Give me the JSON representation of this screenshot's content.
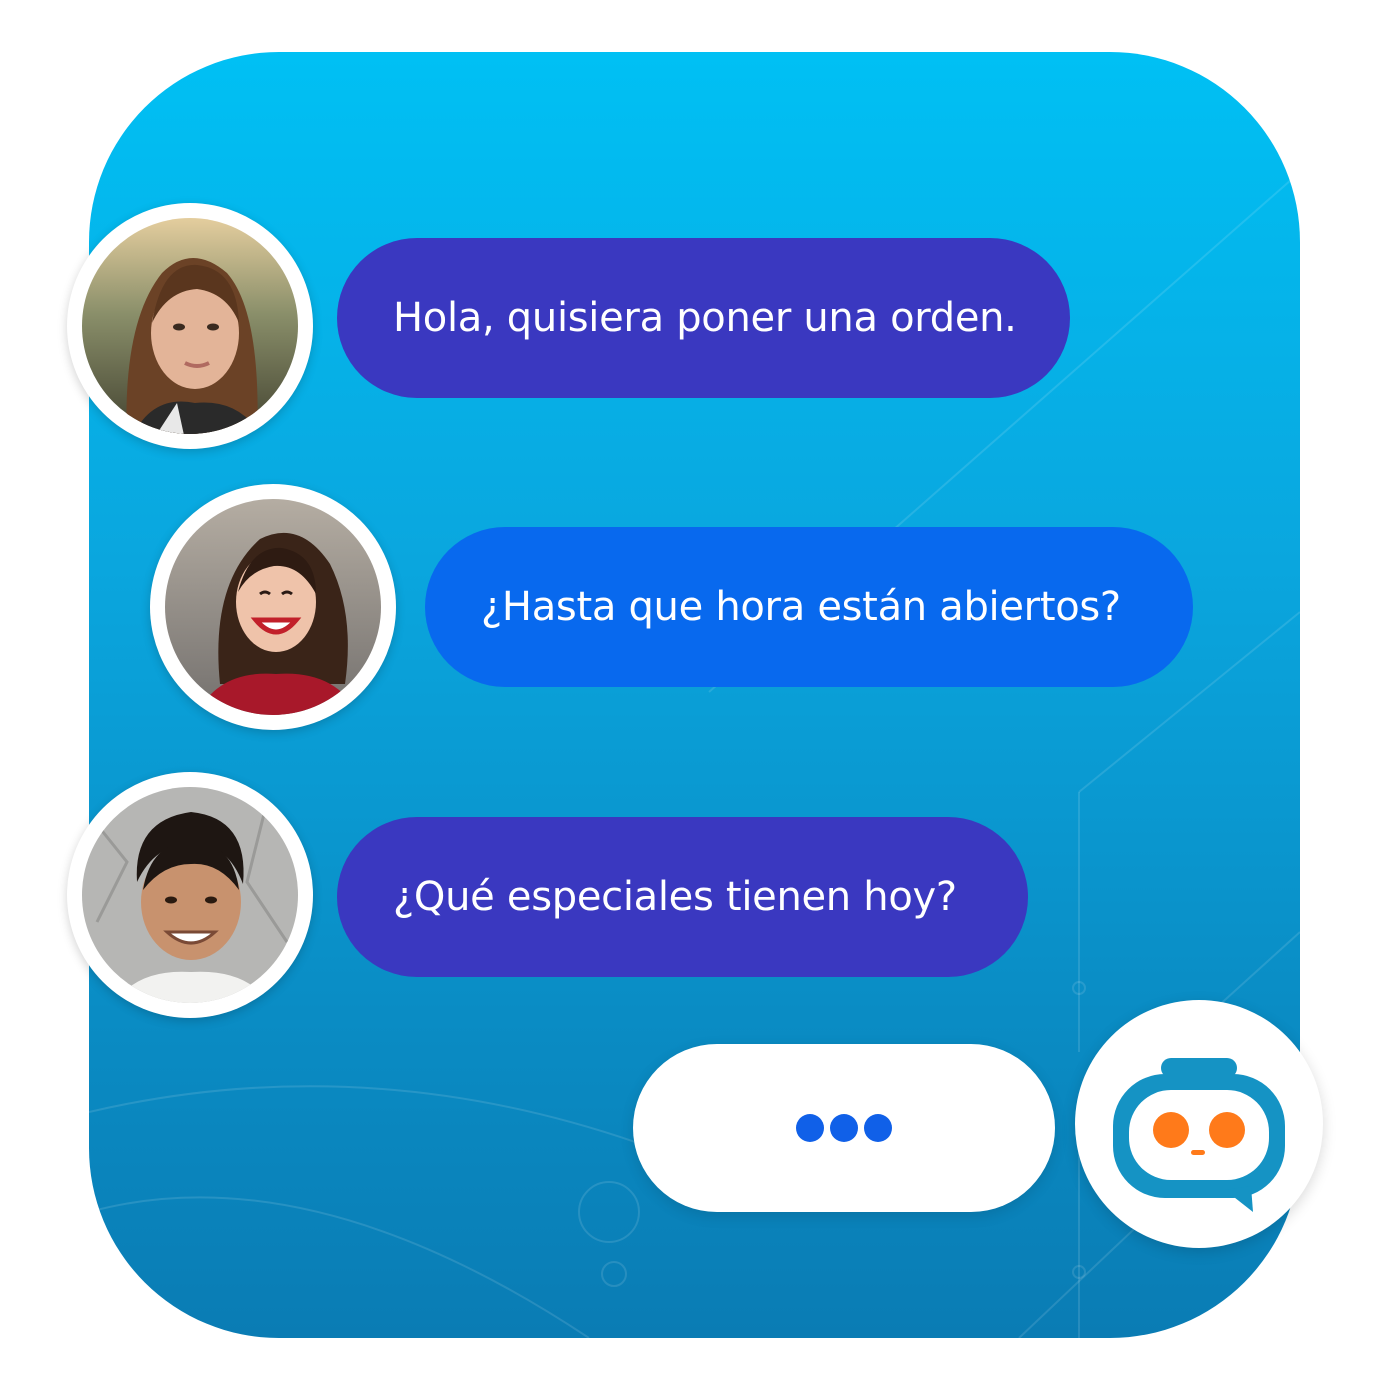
{
  "chat": {
    "messages": [
      {
        "text": "Hola, quisiera poner una orden.",
        "avatar": "user-woman-long-hair"
      },
      {
        "text": "¿Hasta que hora están abiertos?",
        "avatar": "user-woman-smiling"
      },
      {
        "text": "¿Qué especiales tienen hoy?",
        "avatar": "user-man-smiling"
      }
    ],
    "typing_indicator": {
      "icon": "typing-dots-icon"
    },
    "bot": {
      "icon": "robot-icon"
    }
  },
  "colors": {
    "panel_top": "#00c0f4",
    "panel_bottom": "#0a7cb4",
    "bubble_purple": "#3a38c0",
    "bubble_blue": "#0869ee",
    "typing_dot": "#1060e8",
    "bot_face": "#1593c4",
    "bot_eyes": "#ff7a1a"
  }
}
